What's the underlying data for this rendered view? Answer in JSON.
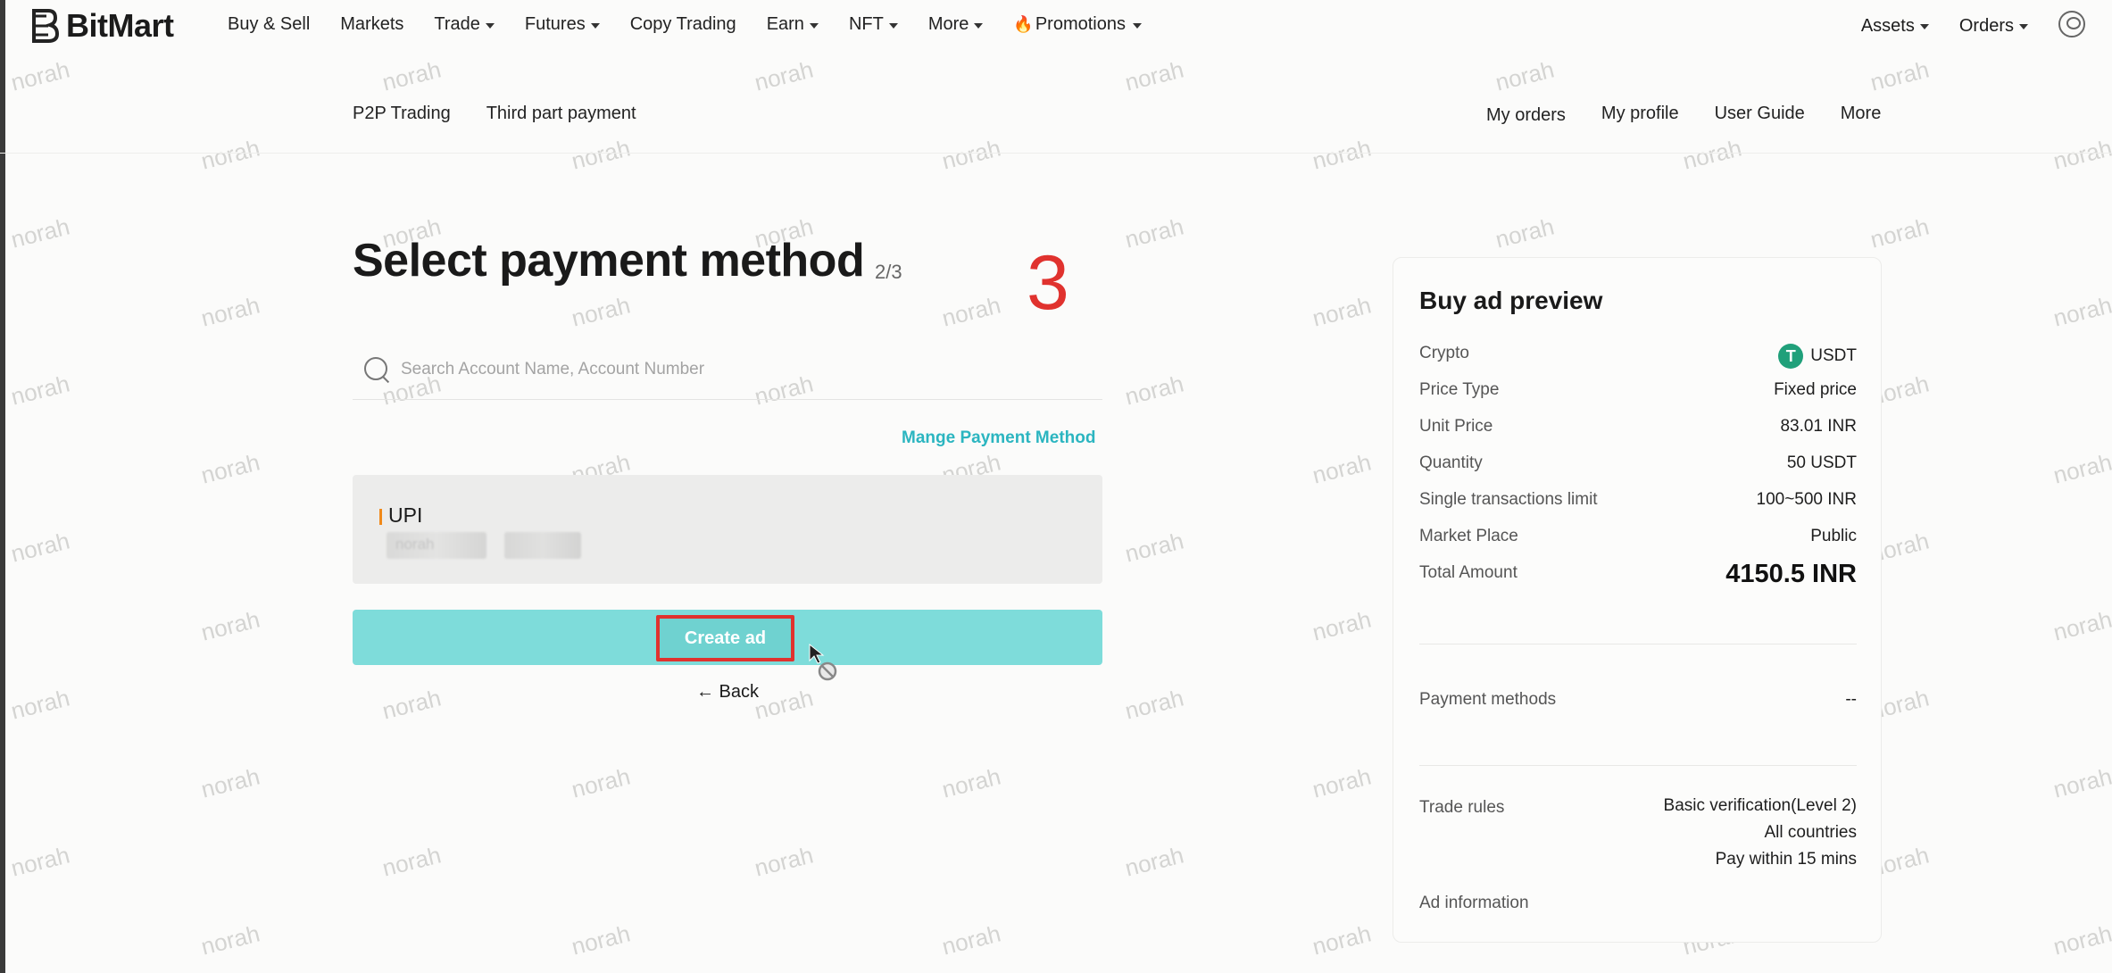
{
  "brand": {
    "name": "BitMart"
  },
  "topnav": {
    "items": [
      {
        "label": "Buy & Sell",
        "caret": false
      },
      {
        "label": "Markets",
        "caret": false
      },
      {
        "label": "Trade",
        "caret": true
      },
      {
        "label": "Futures",
        "caret": true
      },
      {
        "label": "Copy Trading",
        "caret": false
      },
      {
        "label": "Earn",
        "caret": true
      },
      {
        "label": "NFT",
        "caret": true
      },
      {
        "label": "More",
        "caret": true
      },
      {
        "label": "Promotions",
        "caret": true
      }
    ],
    "right": [
      "Assets",
      "Orders"
    ]
  },
  "subnav": {
    "left": [
      "P2P Trading",
      "Third part payment"
    ],
    "right": [
      "My orders",
      "My profile",
      "User Guide",
      "More"
    ]
  },
  "page": {
    "title": "Select payment method",
    "step": "2/3",
    "annotation": "3",
    "search_placeholder": "Search Account Name, Account Number",
    "manage_link": "Mange Payment Method",
    "method": {
      "name": "UPI",
      "blurred_account": "norah"
    },
    "create_button": "Create ad",
    "back_link": "← Back"
  },
  "preview": {
    "title": "Buy ad preview",
    "rows": {
      "crypto": {
        "label": "Crypto",
        "value": "USDT",
        "icon": "tether-icon"
      },
      "price_type": {
        "label": "Price Type",
        "value": "Fixed price"
      },
      "unit_price": {
        "label": "Unit Price",
        "value": "83.01 INR"
      },
      "quantity": {
        "label": "Quantity",
        "value": "50 USDT"
      },
      "limit": {
        "label": "Single transactions limit",
        "value": "100~500 INR"
      },
      "market": {
        "label": "Market Place",
        "value": "Public"
      },
      "total": {
        "label": "Total Amount",
        "value": "4150.5 INR"
      },
      "payment": {
        "label": "Payment methods",
        "value": "--"
      },
      "rules": {
        "label": "Trade rules",
        "lines": [
          "Basic verification(Level 2)",
          "All countries",
          "Pay within 15 mins"
        ]
      },
      "ad_info": {
        "label": "Ad information"
      }
    }
  },
  "watermark": "norah",
  "colors": {
    "accent": "#2bb5c0",
    "button": "#7edcda",
    "annotation": "#e0322e",
    "usdt": "#20a07a"
  }
}
